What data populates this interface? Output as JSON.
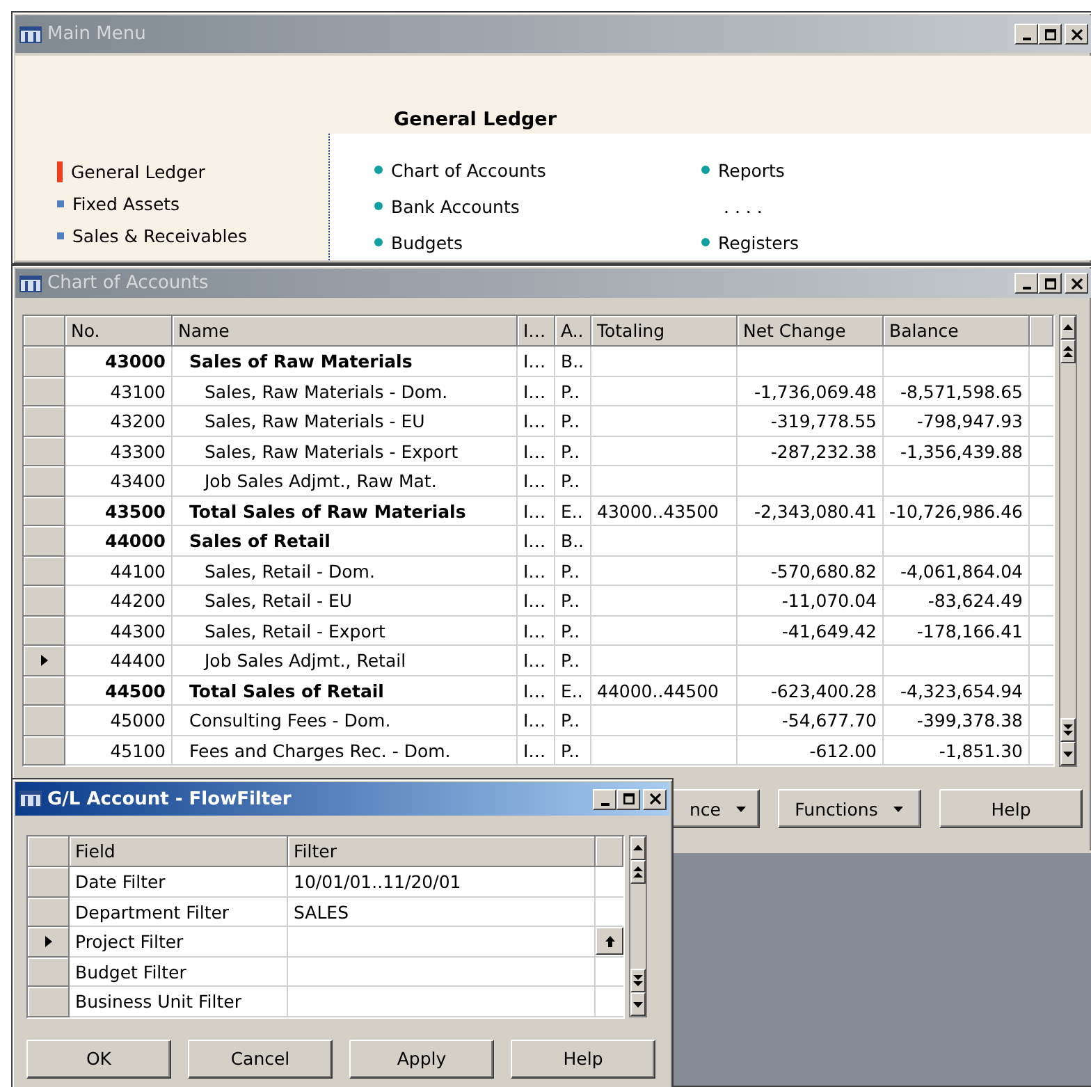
{
  "main_menu": {
    "window": {
      "title": "Main Menu",
      "active": false
    },
    "heading": "General Ledger",
    "sidebar": {
      "items": [
        {
          "label": "General Ledger",
          "selected": true
        },
        {
          "label": "Fixed Assets",
          "selected": false
        },
        {
          "label": "Sales & Receivables",
          "selected": false
        }
      ]
    },
    "link_columns": [
      {
        "items": [
          {
            "kind": "link",
            "label": "Chart of Accounts"
          },
          {
            "kind": "link",
            "label": "Bank Accounts"
          },
          {
            "kind": "link",
            "label": "Budgets"
          }
        ]
      },
      {
        "items": [
          {
            "kind": "link",
            "label": "Reports"
          },
          {
            "kind": "separator",
            "label": ". . . ."
          },
          {
            "kind": "link",
            "label": "Registers"
          }
        ]
      }
    ]
  },
  "chart_of_accounts": {
    "window": {
      "title": "Chart of Accounts",
      "active": false
    },
    "table": {
      "columns": [
        "No.",
        "Name",
        "I…",
        "A..",
        "Totaling",
        "Net Change",
        "Balance"
      ],
      "rows": [
        {
          "bold": true,
          "no": "43000",
          "name": "Sales of Raw Materials",
          "col_3": "I…",
          "col_4": "B..",
          "selected": false,
          "children": [
            {
              "bold": false,
              "no": "43100",
              "name": "Sales, Raw Materials - Dom.",
              "col_3": "I…",
              "col_4": "P..",
              "net_change": "-1,736,069.48",
              "balance": "-8,571,598.65",
              "selected": false
            },
            {
              "bold": false,
              "no": "43200",
              "name": "Sales, Raw Materials - EU",
              "col_3": "I…",
              "col_4": "P..",
              "net_change": "-319,778.55",
              "balance": "-798,947.93",
              "selected": false
            },
            {
              "bold": false,
              "no": "43300",
              "name": "Sales, Raw Materials - Export",
              "col_3": "I…",
              "col_4": "P..",
              "net_change": "-287,232.38",
              "balance": "-1,356,439.88",
              "selected": false
            },
            {
              "bold": false,
              "no": "43400",
              "name": "Job Sales Adjmt., Raw Mat.",
              "col_3": "I…",
              "col_4": "P..",
              "selected": false
            }
          ]
        },
        {
          "bold": true,
          "no": "43500",
          "name": "Total Sales of Raw Materials",
          "col_3": "I…",
          "col_4": "E..",
          "totaling": "43000..43500",
          "net_change": "-2,343,080.41",
          "balance": "-10,726,986.46",
          "selected": false
        },
        {
          "bold": true,
          "no": "44000",
          "name": "Sales of Retail",
          "col_3": "I…",
          "col_4": "B..",
          "selected": false,
          "children": [
            {
              "bold": false,
              "no": "44100",
              "name": "Sales, Retail - Dom.",
              "col_3": "I…",
              "col_4": "P..",
              "net_change": "-570,680.82",
              "balance": "-4,061,864.04",
              "selected": false
            },
            {
              "bold": false,
              "no": "44200",
              "name": "Sales, Retail - EU",
              "col_3": "I…",
              "col_4": "P..",
              "net_change": "-11,070.04",
              "balance": "-83,624.49",
              "selected": false
            },
            {
              "bold": false,
              "no": "44300",
              "name": "Sales, Retail - Export",
              "col_3": "I…",
              "col_4": "P..",
              "net_change": "-41,649.42",
              "balance": "-178,166.41",
              "selected": false
            },
            {
              "bold": false,
              "no": "44400",
              "name": "Job Sales Adjmt., Retail",
              "col_3": "I…",
              "col_4": "P..",
              "selected": true
            }
          ]
        },
        {
          "bold": true,
          "no": "44500",
          "name": "Total Sales of Retail",
          "col_3": "I…",
          "col_4": "E..",
          "totaling": "44000..44500",
          "net_change": "-623,400.28",
          "balance": "-4,323,654.94",
          "selected": false
        },
        {
          "bold": false,
          "no": "45000",
          "name": "Consulting Fees - Dom.",
          "col_3": "I…",
          "col_4": "P..",
          "net_change": "-54,677.70",
          "balance": "-399,378.38",
          "selected": false
        },
        {
          "bold": false,
          "no": "45100",
          "name": "Fees and Charges Rec. - Dom.",
          "col_3": "I…",
          "col_4": "P..",
          "net_change": "-612.00",
          "balance": "-1,851.30",
          "selected": false
        }
      ]
    },
    "buttons": [
      {
        "kind": "menu",
        "label": "nce"
      },
      {
        "kind": "menu",
        "label": "Functions"
      },
      {
        "kind": "plain",
        "label": "Help"
      }
    ]
  },
  "flowfilter": {
    "window": {
      "title": "G/L Account - FlowFilter",
      "active": true
    },
    "table": {
      "columns": [
        "Field",
        "Filter"
      ],
      "rows": [
        {
          "field": "Date Filter",
          "filter": "10/01/01..11/20/01",
          "selected": false
        },
        {
          "field": "Department Filter",
          "filter": "SALES",
          "selected": false
        },
        {
          "field": "Project Filter",
          "selected": true
        },
        {
          "field": "Budget Filter",
          "selected": false
        },
        {
          "field": "Business Unit Filter",
          "selected": false
        }
      ]
    },
    "buttons": [
      "OK",
      "Cancel",
      "Apply",
      "Help"
    ]
  }
}
